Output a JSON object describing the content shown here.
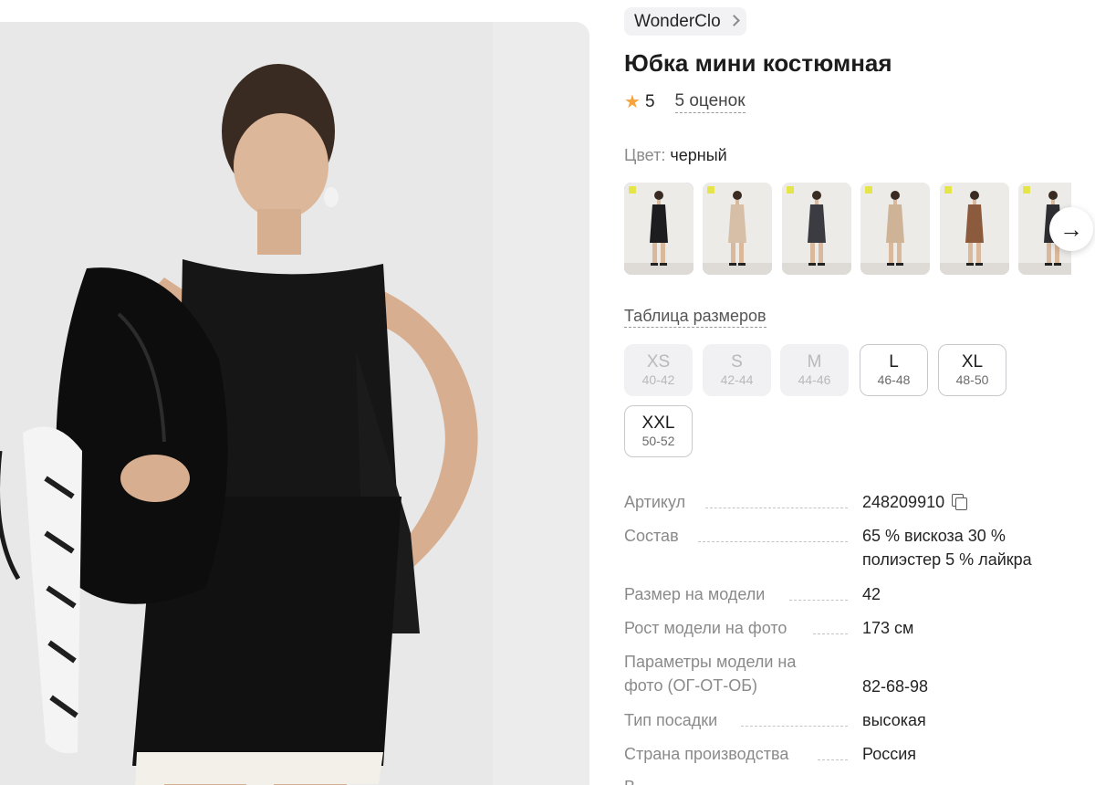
{
  "brand": {
    "name": "WonderClo"
  },
  "product": {
    "title": "Юбка мини костюмная",
    "rating": "5",
    "reviews": "5 оценок"
  },
  "color": {
    "label": "Цвет:",
    "value": "черный"
  },
  "swatches": [
    {
      "name": "black",
      "outfit": "#1d1d1f",
      "bottom": "#1d1d1f",
      "skin": "#d9b89c"
    },
    {
      "name": "beige",
      "outfit": "#d6bfa6",
      "bottom": "#d6bfa6",
      "skin": "#d9b89c"
    },
    {
      "name": "graphite",
      "outfit": "#3b3b42",
      "bottom": "#3b3b42",
      "skin": "#d9b89c"
    },
    {
      "name": "sand",
      "outfit": "#cfb396",
      "bottom": "#cfb396",
      "skin": "#d9b89c"
    },
    {
      "name": "brown",
      "outfit": "#8c5a3c",
      "bottom": "#8c5a3c",
      "skin": "#d9b89c"
    },
    {
      "name": "dark-gray",
      "outfit": "#2e2e33",
      "bottom": "#2e2e33",
      "skin": "#d9b89c"
    }
  ],
  "size_table": {
    "label": "Таблица размеров"
  },
  "sizes": [
    {
      "name": "XS",
      "ru": "40-42",
      "available": false
    },
    {
      "name": "S",
      "ru": "42-44",
      "available": false
    },
    {
      "name": "M",
      "ru": "44-46",
      "available": false
    },
    {
      "name": "L",
      "ru": "46-48",
      "available": true
    },
    {
      "name": "XL",
      "ru": "48-50",
      "available": true
    },
    {
      "name": "XXL",
      "ru": "50-52",
      "available": true
    }
  ],
  "specs": [
    {
      "key": "Артикул",
      "value": "248209910"
    },
    {
      "key": "Состав",
      "value": "65 % вискоза 30 %",
      "value2": "полиэстер 5 % лайкра"
    },
    {
      "key": "Размер на модели",
      "value": "42"
    },
    {
      "key": "Рост модели на фото",
      "value": "173 см"
    },
    {
      "key": "Параметры модели на",
      "key2": "фото (ОГ-ОТ-ОБ)",
      "value": "82-68-98"
    },
    {
      "key": "Тип посадки",
      "value": "высокая"
    },
    {
      "key": "Страна производства",
      "value": "Россия"
    }
  ],
  "colors": {
    "accent": "#8c4dde",
    "star": "#f6a33b"
  }
}
